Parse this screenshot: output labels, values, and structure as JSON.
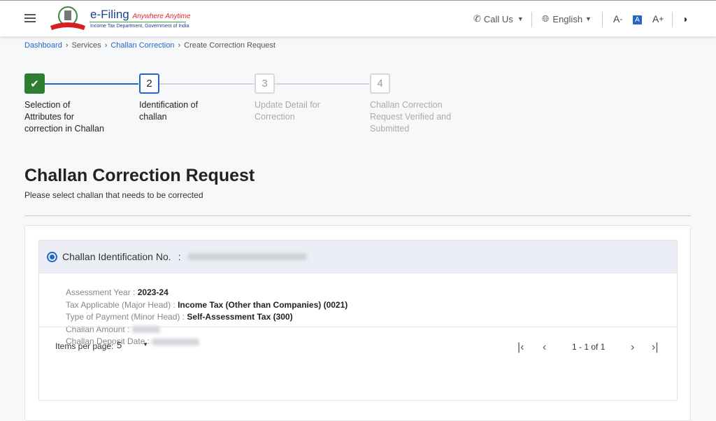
{
  "header": {
    "brand": "e-Filing",
    "tagline": "Anywhere Anytime",
    "subtitle": "Income Tax Department, Government of India",
    "call_us": "Call Us",
    "language": "English",
    "font_decrease": "A",
    "font_reset": "A",
    "font_increase": "A"
  },
  "breadcrumb": [
    "Dashboard",
    "Services",
    "Challan Correction",
    "Create Correction Request"
  ],
  "steps": [
    {
      "num": "1",
      "label": "Selection of Attributes for correction in Challan",
      "state": "done"
    },
    {
      "num": "2",
      "label": "Identification of challan",
      "state": "active"
    },
    {
      "num": "3",
      "label": "Update Detail for Correction",
      "state": "pending"
    },
    {
      "num": "4",
      "label": "Challan Correction Request Verified and Submitted",
      "state": "pending"
    }
  ],
  "page": {
    "title": "Challan Correction Request",
    "subtitle": "Please select challan that needs to be corrected"
  },
  "challan": {
    "id_label": "Challan Identification No.",
    "selected": true,
    "rows": [
      {
        "label": "Assessment Year",
        "value": "2023-24"
      },
      {
        "label": "Tax Applicable (Major Head)",
        "value": "Income Tax (Other than Companies) (0021)"
      },
      {
        "label": "Type of Payment (Minor Head)",
        "value": "Self-Assessment Tax (300)"
      },
      {
        "label": "Challan Amount",
        "value": null
      },
      {
        "label": "Challan Deposit Date",
        "value": null
      }
    ]
  },
  "pager": {
    "items_label": "Items per page:",
    "items_value": "5",
    "range": "1 - 1 of 1"
  },
  "colors": {
    "primary": "#2366c8",
    "success": "#2e7d32"
  }
}
